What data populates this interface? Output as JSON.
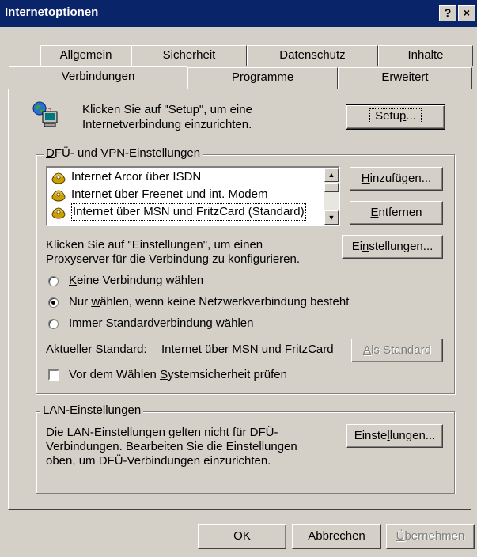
{
  "window": {
    "title": "Internetoptionen",
    "help_label": "?",
    "close_label": "×"
  },
  "tabs": {
    "row1": [
      "Allgemein",
      "Sicherheit",
      "Datenschutz",
      "Inhalte"
    ],
    "row2": [
      "Verbindungen",
      "Programme",
      "Erweitert"
    ],
    "active": "Verbindungen"
  },
  "setup": {
    "text_line1": "Klicken Sie auf \"Setup\", um eine",
    "text_line2": "Internetverbindung einzurichten.",
    "button_pre": "Setu",
    "button_acc": "p",
    "button_post": "..."
  },
  "dialup": {
    "legend_acc": "D",
    "legend_rest": "FÜ- und VPN-Einstellungen",
    "connections": [
      "Internet Arcor über ISDN",
      "Internet über Freenet und int. Modem",
      "Internet über MSN und FritzCard (Standard)"
    ],
    "add_acc": "H",
    "add_rest": "inzufügen...",
    "remove_acc": "E",
    "remove_rest": "ntfernen",
    "proxy_text_line1": "Klicken Sie auf \"Einstellungen\", um einen",
    "proxy_text_line2": "Proxyserver für die Verbindung zu konfigurieren.",
    "settings_pre": "Ei",
    "settings_acc": "n",
    "settings_post": "stellungen...",
    "radio_options": [
      {
        "pre": "",
        "acc": "K",
        "post": "eine Verbindung wählen",
        "checked": false
      },
      {
        "pre": "Nur ",
        "acc": "w",
        "post": "ählen, wenn keine Netzwerkverbindung besteht",
        "checked": true
      },
      {
        "pre": "",
        "acc": "I",
        "post": "mmer Standardverbindung wählen",
        "checked": false
      }
    ],
    "current_default_label": "Aktueller Standard:",
    "current_default_value": "Internet über MSN und FritzCard",
    "set_default_acc": "A",
    "set_default_rest": "ls Standard",
    "security_check_pre": "Vor dem Wählen ",
    "security_check_acc": "S",
    "security_check_post": "ystemsicherheit prüfen",
    "security_checked": false
  },
  "lan": {
    "legend": "LAN-Einstellungen",
    "text_line1": "Die LAN-Einstellungen gelten nicht für DFÜ-",
    "text_line2": "Verbindungen. Bearbeiten Sie die Einstellungen",
    "text_line3": "oben, um DFÜ-Verbindungen einzurichten.",
    "settings_pre": "Einste",
    "settings_acc": "l",
    "settings_post": "lungen..."
  },
  "footer": {
    "ok": "OK",
    "cancel": "Abbrechen",
    "apply_acc": "Ü",
    "apply_rest": "bernehmen"
  }
}
